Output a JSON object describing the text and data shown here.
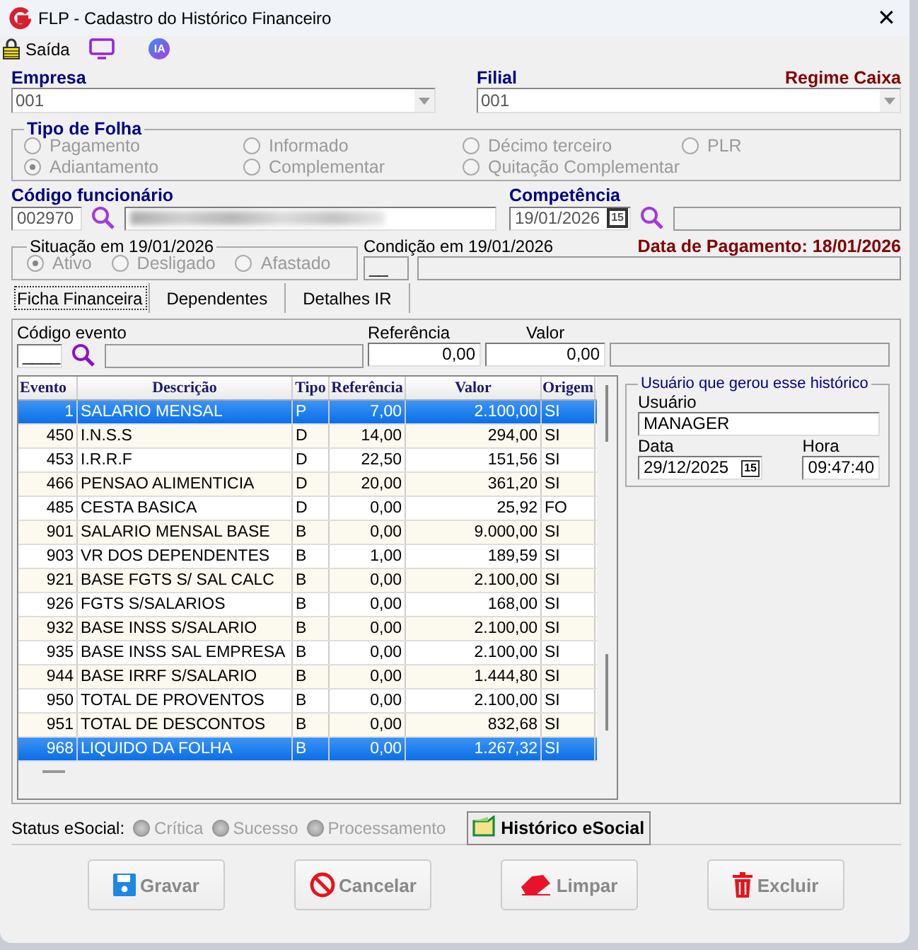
{
  "window": {
    "title": "FLP - Cadastro do Histórico Financeiro",
    "close": "✕"
  },
  "toolbar": {
    "exit_label": "Saída",
    "ai_label": "IA"
  },
  "empresa": {
    "label": "Empresa",
    "value": "001"
  },
  "filial": {
    "label": "Filial",
    "value": "001",
    "regime": "Regime Caixa"
  },
  "tipo_folha": {
    "title": "Tipo de Folha",
    "options": [
      {
        "label": "Pagamento",
        "checked": false
      },
      {
        "label": "Informado",
        "checked": false
      },
      {
        "label": "Décimo terceiro",
        "checked": false
      },
      {
        "label": "PLR",
        "checked": false
      },
      {
        "label": "Adiantamento",
        "checked": true
      },
      {
        "label": "Complementar",
        "checked": false
      },
      {
        "label": "Quitação Complementar",
        "checked": false
      }
    ]
  },
  "funcionario": {
    "label": "Código funcionário",
    "code": "002970"
  },
  "competencia": {
    "label": "Competência",
    "value": "19/01/2026",
    "calendar": "15"
  },
  "situacao": {
    "title": "Situação em  19/01/2026",
    "options": [
      {
        "label": "Ativo",
        "checked": true
      },
      {
        "label": "Desligado",
        "checked": false
      },
      {
        "label": "Afastado",
        "checked": false
      }
    ]
  },
  "condicao": {
    "label": "Condição em 19/01/2026",
    "value": "__"
  },
  "data_pagamento": "Data de Pagamento: 18/01/2026",
  "tabs": [
    {
      "label": "Ficha Financeira",
      "selected": true
    },
    {
      "label": "Dependentes",
      "selected": false
    },
    {
      "label": "Detalhes IR",
      "selected": false
    }
  ],
  "evento_form": {
    "code_label": "Código evento",
    "code_value": "____",
    "ref_label": "Referência",
    "ref_value": "0,00",
    "valor_label": "Valor",
    "valor_value": "0,00"
  },
  "table": {
    "columns": [
      "Evento",
      "Descrição",
      "Tipo",
      "Referência",
      "Valor",
      "Origem"
    ],
    "rows": [
      {
        "cells": [
          "1",
          "SALARIO MENSAL",
          "P",
          "7,00",
          "2.100,00",
          "SI"
        ],
        "selected": true
      },
      {
        "cells": [
          "450",
          "I.N.S.S",
          "D",
          "14,00",
          "294,00",
          "SI"
        ],
        "selected": false
      },
      {
        "cells": [
          "453",
          "I.R.R.F",
          "D",
          "22,50",
          "151,56",
          "SI"
        ],
        "selected": false
      },
      {
        "cells": [
          "466",
          "PENSAO ALIMENTICIA",
          "D",
          "20,00",
          "361,20",
          "SI"
        ],
        "selected": false
      },
      {
        "cells": [
          "485",
          "CESTA BASICA",
          "D",
          "0,00",
          "25,92",
          "FO"
        ],
        "selected": false
      },
      {
        "cells": [
          "901",
          "SALARIO MENSAL BASE",
          "B",
          "0,00",
          "9.000,00",
          "SI"
        ],
        "selected": false
      },
      {
        "cells": [
          "903",
          "VR DOS DEPENDENTES",
          "B",
          "1,00",
          "189,59",
          "SI"
        ],
        "selected": false
      },
      {
        "cells": [
          "921",
          "BASE FGTS S/ SAL CALC",
          "B",
          "0,00",
          "2.100,00",
          "SI"
        ],
        "selected": false
      },
      {
        "cells": [
          "926",
          "FGTS S/SALARIOS",
          "B",
          "0,00",
          "168,00",
          "SI"
        ],
        "selected": false
      },
      {
        "cells": [
          "932",
          "BASE INSS S/SALARIO",
          "B",
          "0,00",
          "2.100,00",
          "SI"
        ],
        "selected": false
      },
      {
        "cells": [
          "935",
          "BASE INSS SAL EMPRESA",
          "B",
          "0,00",
          "2.100,00",
          "SI"
        ],
        "selected": false
      },
      {
        "cells": [
          "944",
          "BASE IRRF S/SALARIO",
          "B",
          "0,00",
          "1.444,80",
          "SI"
        ],
        "selected": false
      },
      {
        "cells": [
          "950",
          "TOTAL DE PROVENTOS",
          "B",
          "0,00",
          "2.100,00",
          "SI"
        ],
        "selected": false
      },
      {
        "cells": [
          "951",
          "TOTAL DE DESCONTOS",
          "B",
          "0,00",
          "832,68",
          "SI"
        ],
        "selected": false
      },
      {
        "cells": [
          "968",
          "LIQUIDO DA FOLHA",
          "B",
          "0,00",
          "1.267,32",
          "SI"
        ],
        "selected": true
      }
    ]
  },
  "usuario_box": {
    "title": "Usuário que gerou esse histórico",
    "user_label": "Usuário",
    "user": "MANAGER",
    "date_label": "Data",
    "date": "29/12/2025",
    "calendar": "15",
    "time_label": "Hora",
    "time": "09:47:40"
  },
  "status": {
    "label": "Status eSocial:",
    "lamps": [
      "Crítica",
      "Sucesso",
      "Processamento"
    ],
    "history_button": "Histórico eSocial"
  },
  "buttons": [
    {
      "label": "Gravar",
      "kind": "save",
      "disabled": true
    },
    {
      "label": "Cancelar",
      "kind": "cancel",
      "disabled": true
    },
    {
      "label": "Limpar",
      "kind": "eraser",
      "disabled": true
    },
    {
      "label": "Excluir",
      "kind": "trash",
      "disabled": true
    }
  ]
}
